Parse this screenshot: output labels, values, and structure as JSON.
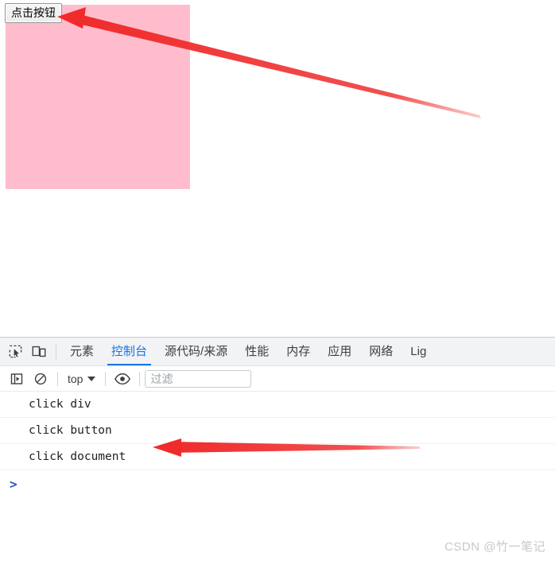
{
  "page": {
    "button_label": "点击按钮",
    "div_color": "#ffbccd",
    "button_bg": "#ededed"
  },
  "devtools": {
    "accent_color": "#1a73e8",
    "toolbar_bg": "#f1f3f4",
    "icons": {
      "inspect": "inspect-element-icon",
      "device": "device-toolbar-icon"
    },
    "tabs": [
      {
        "label": "元素",
        "active": false
      },
      {
        "label": "控制台",
        "active": true
      },
      {
        "label": "源代码/来源",
        "active": false
      },
      {
        "label": "性能",
        "active": false
      },
      {
        "label": "内存",
        "active": false
      },
      {
        "label": "应用",
        "active": false
      },
      {
        "label": "网络",
        "active": false
      },
      {
        "label": "Lig",
        "active": false
      }
    ],
    "console_toolbar": {
      "sidebar_toggle": "show-console-sidebar-icon",
      "clear_label": "clear-console-icon",
      "context": "top",
      "eye_label": "live-expression-eye-icon",
      "filter_placeholder": "过滤",
      "filter_value": ""
    },
    "console_messages": [
      {
        "text": "click div"
      },
      {
        "text": "click button"
      },
      {
        "text": "click document"
      }
    ],
    "prompt_caret": ">"
  },
  "annotations": {
    "arrow_to_button": "red-arrow-pointing-to-button",
    "arrow_to_log": "red-arrow-pointing-to-click-button-log"
  },
  "watermark": {
    "text": "CSDN @竹一笔记"
  }
}
